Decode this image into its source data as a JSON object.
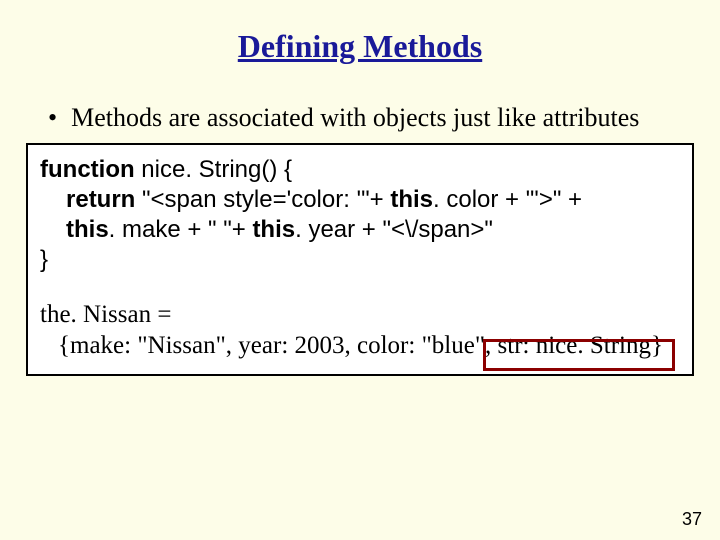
{
  "title": "Defining Methods",
  "bullet1": "Methods are associated with objects just like attributes",
  "code": {
    "func_kw": "function",
    "func_sig": " nice. String() {",
    "return_kw": "return",
    "ret_tail1": " \"<span style='color: '\"+  ",
    "this1": "this",
    "ret_tail2": ". color + \"'>\" +",
    "this2": "this",
    "line3_a": ". make + \" \"+ ",
    "this3": "this",
    "line3_b": ". year + \"<\\/span>\"",
    "close": "}",
    "obj_lhs": "the. Nissan =",
    "obj_rhs": "{make: \"Nissan\", year: 2003, color: \"blue\", str: nice. String}"
  },
  "page_number": "37"
}
